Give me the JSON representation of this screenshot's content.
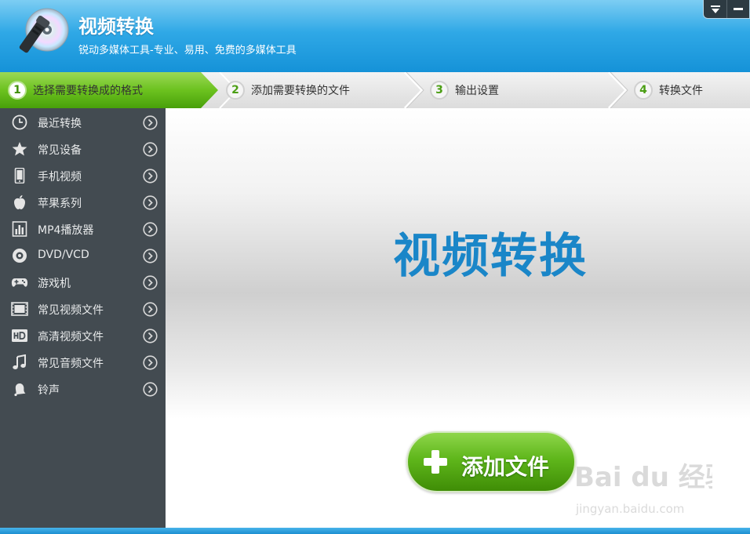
{
  "app": {
    "title": "视频转换",
    "subtitle": "锐动多媒体工具-专业、易用、免费的多媒体工具"
  },
  "window_controls": [
    {
      "icon": "menu-dropdown-icon"
    },
    {
      "icon": "minimize-icon"
    }
  ],
  "steps": [
    {
      "num": "1",
      "label": "选择需要转换成的格式",
      "active": true
    },
    {
      "num": "2",
      "label": "添加需要转换的文件",
      "active": false
    },
    {
      "num": "3",
      "label": "输出设置",
      "active": false
    },
    {
      "num": "4",
      "label": "转换文件",
      "active": false
    }
  ],
  "sidebar": {
    "items": [
      {
        "label": "最近转换",
        "icon": "clock-icon"
      },
      {
        "label": "常见设备",
        "icon": "star-icon"
      },
      {
        "label": "手机视频",
        "icon": "phone-icon"
      },
      {
        "label": "苹果系列",
        "icon": "apple-icon"
      },
      {
        "label": "MP4播放器",
        "icon": "mp4-player-icon"
      },
      {
        "label": "DVD/VCD",
        "icon": "disc-icon"
      },
      {
        "label": "游戏机",
        "icon": "gamepad-icon"
      },
      {
        "label": "常见视频文件",
        "icon": "film-icon"
      },
      {
        "label": "高清视频文件",
        "icon": "hd-icon"
      },
      {
        "label": "常见音频文件",
        "icon": "music-note-icon"
      },
      {
        "label": "铃声",
        "icon": "bell-icon"
      }
    ]
  },
  "main": {
    "title": "视频转换",
    "add_button": "添加文件"
  },
  "watermark": {
    "brand": "Bai du 经验",
    "url": "jingyan.baidu.com"
  },
  "colors": {
    "header_blue": "#1592d8",
    "title_blue": "#1a86c8",
    "active_step_green": "#5fb61b",
    "sidebar_bg": "#434b51"
  }
}
